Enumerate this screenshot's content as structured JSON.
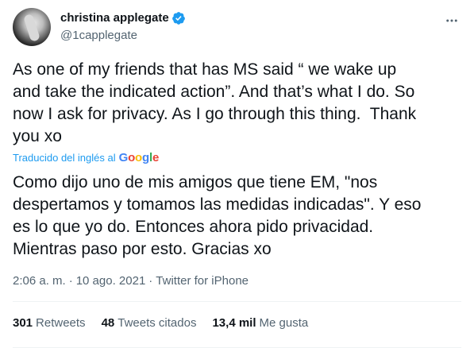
{
  "author": {
    "display_name": "christina applegate",
    "handle": "@1capplegate",
    "verified_icon": "verified-badge-icon",
    "avatar_icon": "profile-photo"
  },
  "more_icon": "more-horizontal-icon",
  "tweet": {
    "text": "As one of my friends that has MS said “ we wake up\nand take the indicated action”. And that’s what I do. So\nnow I ask for privacy. As I go through this thing.  Thank\nyou xo",
    "translated_by_label": "Traducido del inglés al",
    "translator_brand": "Google",
    "translated_text": "Como dijo uno de mis amigos que tiene EM, \"nos\ndespertamos y tomamos las medidas indicadas\". Y eso\nes lo que yo do. Entonces ahora pido privacidad.\nMientras paso por esto. Gracias xo"
  },
  "meta": {
    "time": "2:06 a. m.",
    "separator": "·",
    "date": "10 ago. 2021",
    "source": "Twitter for iPhone"
  },
  "stats": {
    "retweets_count": "301",
    "retweets_label": "Retweets",
    "quotes_count": "48",
    "quotes_label": "Tweets citados",
    "likes_count": "13,4 mil",
    "likes_label": "Me gusta"
  },
  "colors": {
    "text_primary": "#0f1419",
    "text_secondary": "#536471",
    "accent": "#1d9bf0",
    "google_blue": "#4285f4",
    "google_red": "#ea4335",
    "google_yellow": "#fbbc05",
    "google_green": "#34a853",
    "divider": "#eff3f4"
  }
}
